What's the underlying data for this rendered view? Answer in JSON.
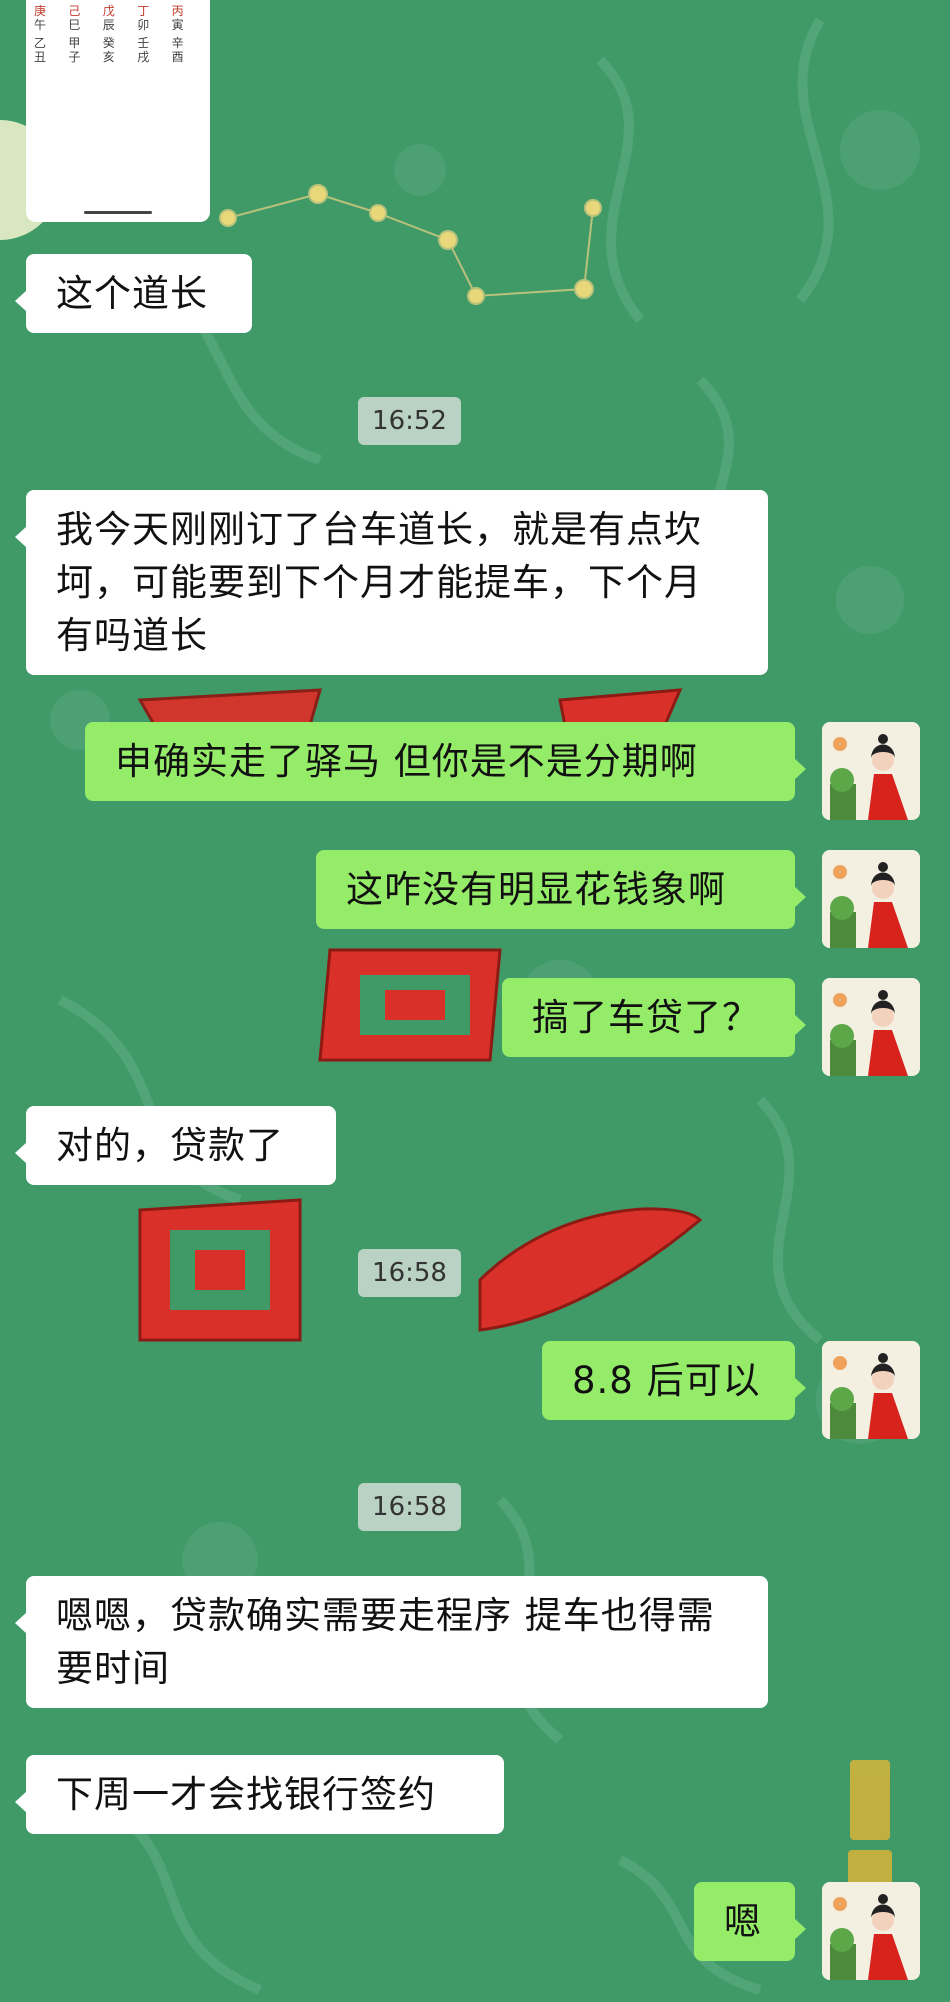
{
  "theme": {
    "background": "#3f9a68",
    "incoming_bubble": "#ffffff",
    "outgoing_bubble": "#95ec69",
    "timestamp_bg": "#dde2dd"
  },
  "top_image": {
    "top_row": [
      "庚",
      "午",
      "己",
      "巳",
      "戊",
      "辰",
      "丁",
      "卯",
      "丙",
      "寅"
    ],
    "bottom_row": [
      "乙",
      "丑",
      "甲",
      "子",
      "癸",
      "亥",
      "壬",
      "戌",
      "辛",
      "酉"
    ]
  },
  "messages": {
    "m1": "这个道长",
    "t1": "16:52",
    "m2": "我今天刚刚订了台车道长，就是有点坎坷，可能要到下个月才能提车，下个月有吗道长",
    "m3": "申确实走了驿马  但你是不是分期啊",
    "m4": "这咋没有明显花钱象啊",
    "m5": "搞了车贷了？",
    "m6": "对的，贷款了",
    "t2": "16:58",
    "m7": "8.8 后可以",
    "t3": "16:58",
    "m8": "嗯嗯，贷款确实需要走程序  提车也得需要时间",
    "m9": "下周一才会找银行签约",
    "m10": "嗯"
  },
  "icons": {
    "avatar": "avatar-woman-red-hanfu-icon"
  }
}
